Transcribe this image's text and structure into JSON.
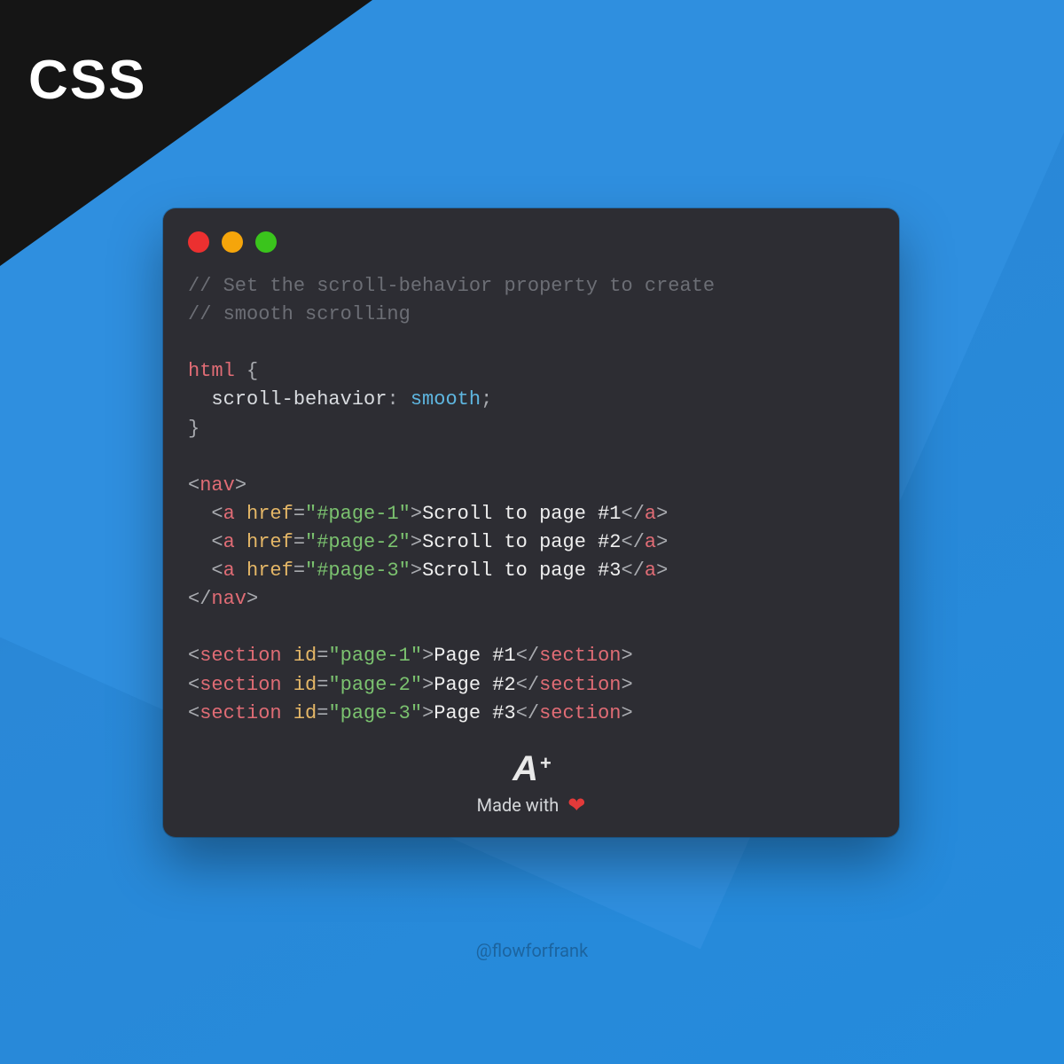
{
  "corner": {
    "label": "CSS"
  },
  "code": {
    "comment1": "// Set the scroll-behavior property to create",
    "comment2": "// smooth scrolling",
    "selector": "html",
    "brace_open": "{",
    "property": "scroll-behavior",
    "colon": ":",
    "value": "smooth",
    "semicolon": ";",
    "brace_close": "}",
    "nav_open": "nav",
    "a": "a",
    "href_attr": "href",
    "eq": "=",
    "href1": "\"#page-1\"",
    "href2": "\"#page-2\"",
    "href3": "\"#page-3\"",
    "link1_text": "Scroll to page #1",
    "link2_text": "Scroll to page #2",
    "link3_text": "Scroll to page #3",
    "section": "section",
    "id_attr": "id",
    "id1": "\"page-1\"",
    "id2": "\"page-2\"",
    "id3": "\"page-3\"",
    "sec1_text": "Page #1",
    "sec2_text": "Page #2",
    "sec3_text": "Page #3"
  },
  "footer": {
    "logo_a": "A",
    "logo_plus": "+",
    "made": "Made with",
    "heart": "❤"
  },
  "handle": "@flowforfrank"
}
